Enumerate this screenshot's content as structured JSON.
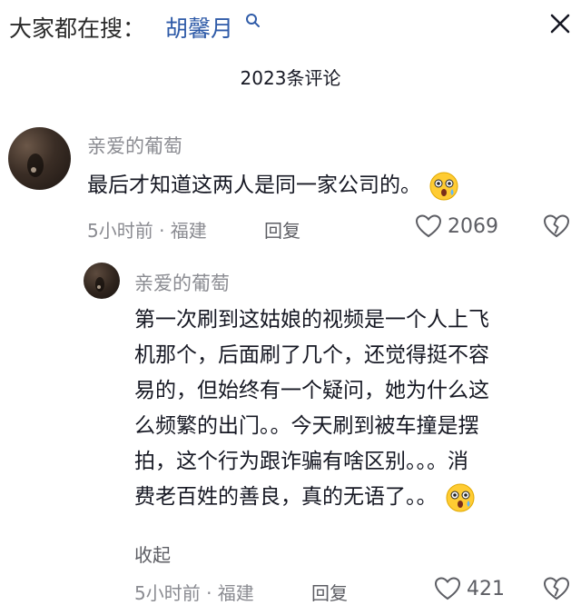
{
  "search": {
    "prefix": "大家都在搜：",
    "term": "胡馨月"
  },
  "comments_header": {
    "count_label": "2023条评论"
  },
  "comment": {
    "username": "亲爱的葡萄",
    "text": "最后才知道这两人是同一家公司的。",
    "emoji": "astonished-emoji",
    "time": "5小时前 · 福建",
    "reply_label": "回复",
    "like_count": "2069"
  },
  "reply": {
    "username": "亲爱的葡萄",
    "lines": [
      "第一次刷到这姑娘的视频是一个人上飞",
      "机那个，后面刷了几个，还觉得挺不容",
      "易的，但始终有一个疑问，她为什么这",
      "么频繁的出门。。今天刷到被车撞是摆",
      "拍，这个行为跟诈骗有啥区别。。。消",
      "费老百姓的善良，真的无语了。。"
    ],
    "emoji": "astonished-emoji",
    "collapse_label": "收起",
    "time": "5小时前 · 福建",
    "reply_label": "回复",
    "like_count": "421"
  },
  "icons": {
    "search": "search-icon",
    "close": "close-icon",
    "like": "heart-icon",
    "dislike": "broken-heart-icon"
  },
  "colors": {
    "accent_link": "#2f5ba8",
    "text_primary": "#161823",
    "text_secondary": "#8a8b91"
  }
}
